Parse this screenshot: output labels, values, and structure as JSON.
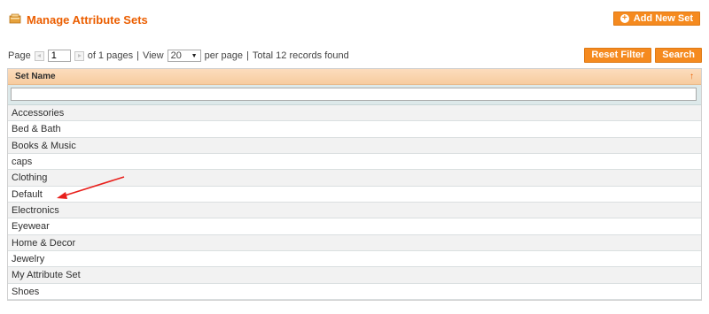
{
  "header": {
    "title": "Manage Attribute Sets",
    "add_button": "Add New Set"
  },
  "pager": {
    "page_label": "Page",
    "page_value": "1",
    "of_pages": "of 1 pages",
    "sep1": "|",
    "view_label": "View",
    "view_value": "20",
    "per_page": "per page",
    "sep2": "|",
    "total": "Total 12 records found",
    "reset_button": "Reset Filter",
    "search_button": "Search"
  },
  "grid": {
    "column": "Set Name",
    "sort_symbol": "↑",
    "rows": [
      "Accessories",
      "Bed & Bath",
      "Books & Music",
      "caps",
      "Clothing",
      "Default",
      "Electronics",
      "Eyewear",
      "Home & Decor",
      "Jewelry",
      "My Attribute Set",
      "Shoes"
    ]
  },
  "colors": {
    "accent": "#eb5e00",
    "button": "#f58a1f",
    "annotation_arrow": "#e8201c"
  }
}
